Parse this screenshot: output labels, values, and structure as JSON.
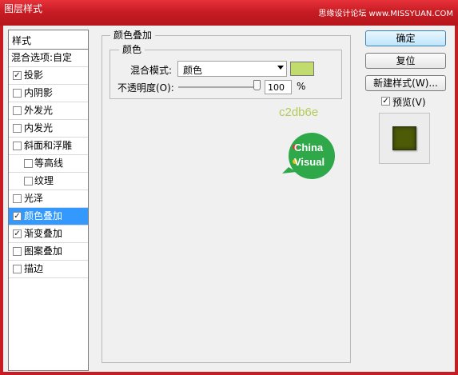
{
  "window": {
    "title": "图层样式",
    "watermark": "思缘设计论坛 www.MISSYUAN.COM"
  },
  "styles": {
    "header": "样式",
    "blending_options": "混合选项:自定",
    "items": [
      {
        "label": "投影",
        "checked": true
      },
      {
        "label": "内阴影",
        "checked": false
      },
      {
        "label": "外发光",
        "checked": false
      },
      {
        "label": "内发光",
        "checked": false
      },
      {
        "label": "斜面和浮雕",
        "checked": false
      },
      {
        "label": "等高线",
        "checked": false
      },
      {
        "label": "纹理",
        "checked": false
      },
      {
        "label": "光泽",
        "checked": false
      },
      {
        "label": "颜色叠加",
        "checked": true,
        "selected": true
      },
      {
        "label": "渐变叠加",
        "checked": true
      },
      {
        "label": "图案叠加",
        "checked": false
      },
      {
        "label": "描边",
        "checked": false
      }
    ]
  },
  "color_overlay": {
    "group_title": "颜色叠加",
    "sub_title": "颜色",
    "blend_mode_label": "混合模式:",
    "blend_mode_value": "颜色",
    "overlay_color": "#c2db6e",
    "opacity_label": "不透明度(O):",
    "opacity_value": "100",
    "opacity_unit": "%",
    "opacity_level": 1.0,
    "color_annotation": "c2db6e"
  },
  "logo": {
    "line1": "China",
    "line2": "Visual",
    "color": "#2fa84a"
  },
  "buttons": {
    "ok": "确定",
    "reset": "复位",
    "new_style": "新建样式(W)...",
    "preview_label": "预览(V)",
    "preview_checked": true
  },
  "preview": {
    "swatch_color": "#4d5a06"
  }
}
